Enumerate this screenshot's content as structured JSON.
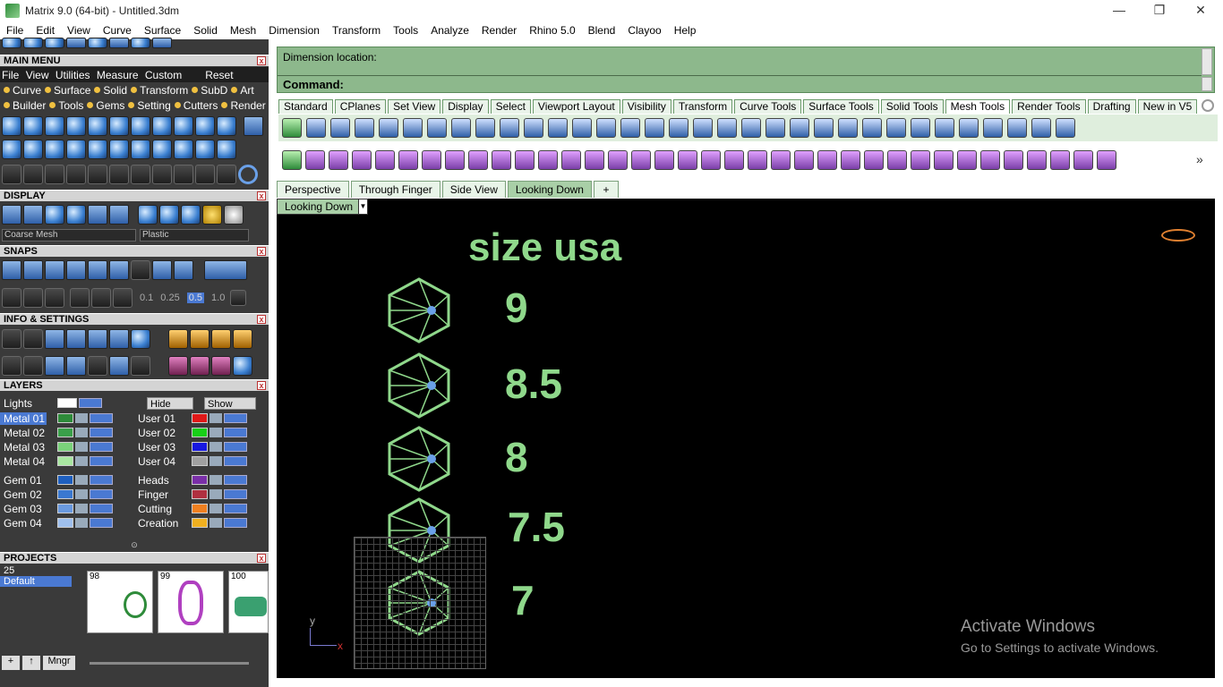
{
  "window": {
    "title": "Matrix 9.0 (64-bit) - Untitled.3dm",
    "minimize": "—",
    "restore": "❐",
    "close": "✕"
  },
  "menubar": [
    "File",
    "Edit",
    "View",
    "Curve",
    "Surface",
    "Solid",
    "Mesh",
    "Dimension",
    "Transform",
    "Tools",
    "Analyze",
    "Render",
    "Rhino 5.0",
    "Blend",
    "Clayoo",
    "Help"
  ],
  "left": {
    "main_menu": {
      "title": "MAIN MENU",
      "row1": [
        "File",
        "View",
        "Utilities",
        "Measure",
        "Custom",
        "Reset"
      ],
      "row2": [
        "Curve",
        "Surface",
        "Solid",
        "Transform",
        "SubD",
        "Art"
      ],
      "row3": [
        "Builder",
        "Tools",
        "Gems",
        "Setting",
        "Cutters",
        "Render"
      ]
    },
    "display": {
      "title": "DISPLAY",
      "mesh": "Coarse Mesh",
      "material": "Plastic"
    },
    "snaps": {
      "title": "SNAPS",
      "values": [
        "0.1",
        "0.25",
        "0.5",
        "1.0"
      ]
    },
    "info": {
      "title": "INFO & SETTINGS"
    },
    "layers": {
      "title": "LAYERS",
      "lights": "Lights",
      "hide": "Hide",
      "show": "Show",
      "left": [
        {
          "name": "Metal 01",
          "color": "#2e8b3a",
          "selected": true
        },
        {
          "name": "Metal 02",
          "color": "#3aa04a"
        },
        {
          "name": "Metal 03",
          "color": "#7ad27a"
        },
        {
          "name": "Metal 04",
          "color": "#a8e6a0"
        },
        {
          "name": "Gem 01",
          "color": "#1e5fbf"
        },
        {
          "name": "Gem 02",
          "color": "#3a78d0"
        },
        {
          "name": "Gem 03",
          "color": "#6a9ae0"
        },
        {
          "name": "Gem 04",
          "color": "#9fc0ee"
        }
      ],
      "right": [
        {
          "name": "User 01",
          "color": "#e01818"
        },
        {
          "name": "User 02",
          "color": "#18d018"
        },
        {
          "name": "User 03",
          "color": "#1818e0"
        },
        {
          "name": "User 04",
          "color": "#a0a0a0"
        },
        {
          "name": "Heads",
          "color": "#7a2fa8"
        },
        {
          "name": "Finger",
          "color": "#b03040"
        },
        {
          "name": "Cutting",
          "color": "#f08020"
        },
        {
          "name": "Creation",
          "color": "#f0b020"
        }
      ]
    },
    "projects": {
      "title": "PROJECTS",
      "list": [
        "25",
        "Default"
      ],
      "thumbs": [
        "98",
        "99",
        "100"
      ],
      "mngr": "Mngr"
    }
  },
  "command": {
    "prompt1": "Dimension location:",
    "prompt2": "Command:"
  },
  "toolbar_tabs": [
    "Standard",
    "CPlanes",
    "Set View",
    "Display",
    "Select",
    "Viewport Layout",
    "Visibility",
    "Transform",
    "Curve Tools",
    "Surface Tools",
    "Solid Tools",
    "Mesh Tools",
    "Render Tools",
    "Drafting",
    "New in V5"
  ],
  "active_toolbar_tab": "Mesh Tools",
  "viewport_tabs": [
    "Perspective",
    "Through Finger",
    "Side View",
    "Looking Down"
  ],
  "active_viewport": "Looking Down",
  "viewport": {
    "label": "Looking Down",
    "heading": "size usa",
    "sizes": [
      "9",
      "8.5",
      "8",
      "7.5",
      "7"
    ],
    "axis_y": "y",
    "axis_x": "x",
    "text_color": "#8fd88b"
  },
  "watermark": {
    "line1": "Activate Windows",
    "line2": "Go to Settings to activate Windows."
  }
}
